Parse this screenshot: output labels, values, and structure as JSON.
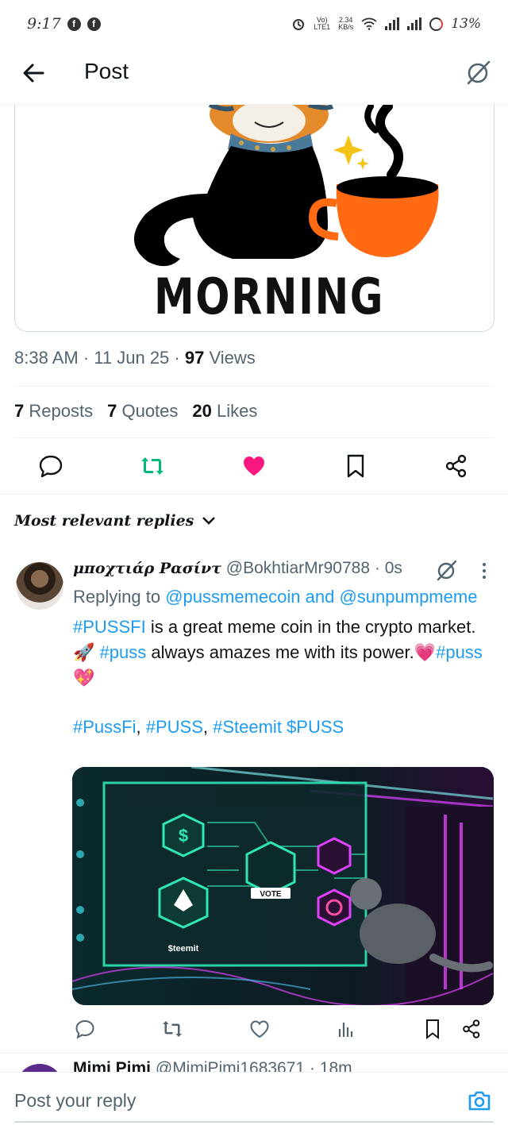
{
  "status_bar": {
    "time": "9:17",
    "fb_glyph": "f",
    "volte_top": "Vo)",
    "volte_bottom": "LTE1",
    "speed_top": "2.34",
    "speed_bottom": "KB/s",
    "battery": "13%"
  },
  "header": {
    "title": "Post"
  },
  "post": {
    "image_caption": "MORNING",
    "time": "8:38 AM",
    "date": "11 Jun 25",
    "views_count": "97",
    "views_label": "Views",
    "reposts_count": "7",
    "reposts_label": "Reposts",
    "quotes_count": "7",
    "quotes_label": "Quotes",
    "likes_count": "20",
    "likes_label": "Likes",
    "accent_color": "#00ba7c",
    "like_color": "#f91880"
  },
  "replies_filter": "Most relevant replies",
  "reply": {
    "name": "μποχτιάρ Ρασίντ",
    "handle": "@BokhtiarMr90788",
    "time": "0s",
    "replying_prefix": "Replying to",
    "replying_user1": "@pussmemecoin",
    "replying_and": "and",
    "replying_user2": "@sunpumpmeme",
    "tag1": "#PUSSFI",
    "text1": " is a great meme coin in the crypto market. 🚀 ",
    "tag2": "#puss",
    "text2": " always amazes me with its power.💗",
    "tag3": "#puss",
    "text3": "💖",
    "tag4": "#PussFi",
    "sep1": ", ",
    "tag5": "#PUSS",
    "sep2": ", ",
    "tag6": "#Steemit",
    "sep3": " ",
    "tag7": "$PUSS",
    "image_labels": {
      "vote": "VOTE",
      "steemit": "$teemit",
      "dollar": "$"
    }
  },
  "next_reply": {
    "name": "Mimi Pimi",
    "handle": "@MimiPimi1683671",
    "time": "18m"
  },
  "composer": {
    "placeholder": "Post your reply"
  }
}
